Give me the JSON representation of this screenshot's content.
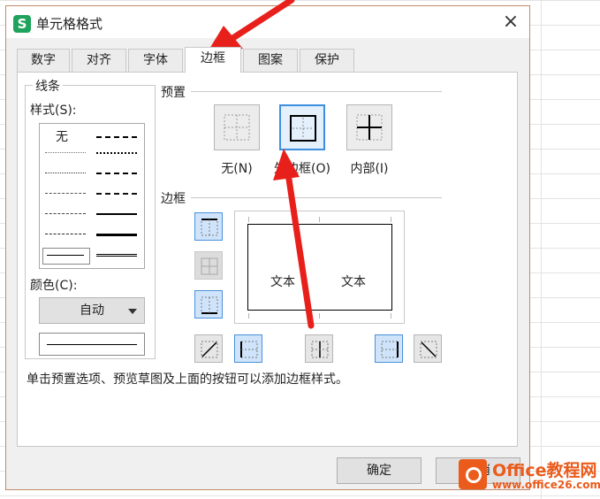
{
  "window": {
    "title": "单元格格式",
    "app_icon_letter": "S",
    "close_glyph": "×"
  },
  "tabs": [
    "数字",
    "对齐",
    "字体",
    "边框",
    "图案",
    "保护"
  ],
  "active_tab": "边框",
  "line_group": {
    "legend": "线条",
    "style_label": "样式(S):",
    "none_option": "无",
    "color_label": "颜色(C):",
    "color_value": "自动"
  },
  "presets": {
    "legend": "预置",
    "items": [
      {
        "label": "无(N)",
        "icon": "border-none-icon"
      },
      {
        "label": "外边框(O)",
        "icon": "border-outline-icon"
      },
      {
        "label": "内部(I)",
        "icon": "border-inside-icon"
      }
    ],
    "selected": "外边框(O)"
  },
  "border": {
    "legend": "边框",
    "preview_texts": [
      "文本",
      "文本"
    ]
  },
  "hint": "单击预置选项、预览草图及上面的按钮可以添加边框样式。",
  "buttons": {
    "ok": "确定",
    "cancel": "取消"
  },
  "watermark": {
    "name": "Office教程网",
    "url": "www.office26.com"
  },
  "colors": {
    "accent": "#3e8ede",
    "annotation_arrow": "#e8201c",
    "app_icon": "#1fa35c",
    "watermark": "#ea5b1c"
  }
}
